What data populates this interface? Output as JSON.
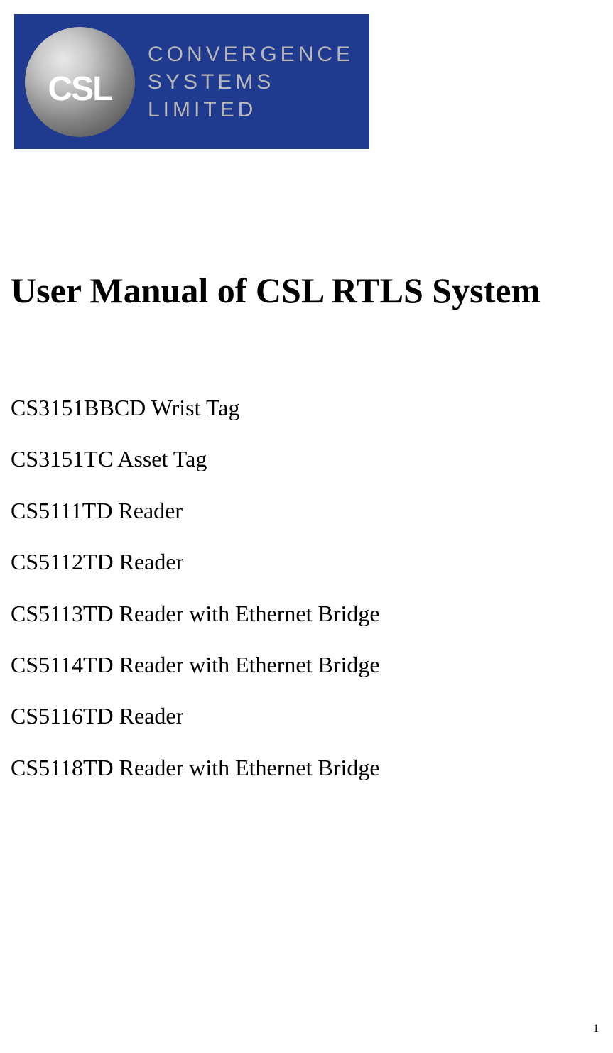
{
  "logo": {
    "sphere_text": "CSL",
    "company_line1": "CONVERGENCE",
    "company_line2": "SYSTEMS LIMITED"
  },
  "title": "User Manual of CSL RTLS System",
  "products": [
    "CS3151BBCD Wrist Tag",
    "CS3151TC Asset Tag",
    "CS5111TD Reader",
    "CS5112TD Reader",
    "CS5113TD Reader with Ethernet Bridge",
    "CS5114TD Reader with Ethernet Bridge",
    "CS5116TD Reader",
    "CS5118TD Reader with Ethernet Bridge"
  ],
  "page_number": "1"
}
